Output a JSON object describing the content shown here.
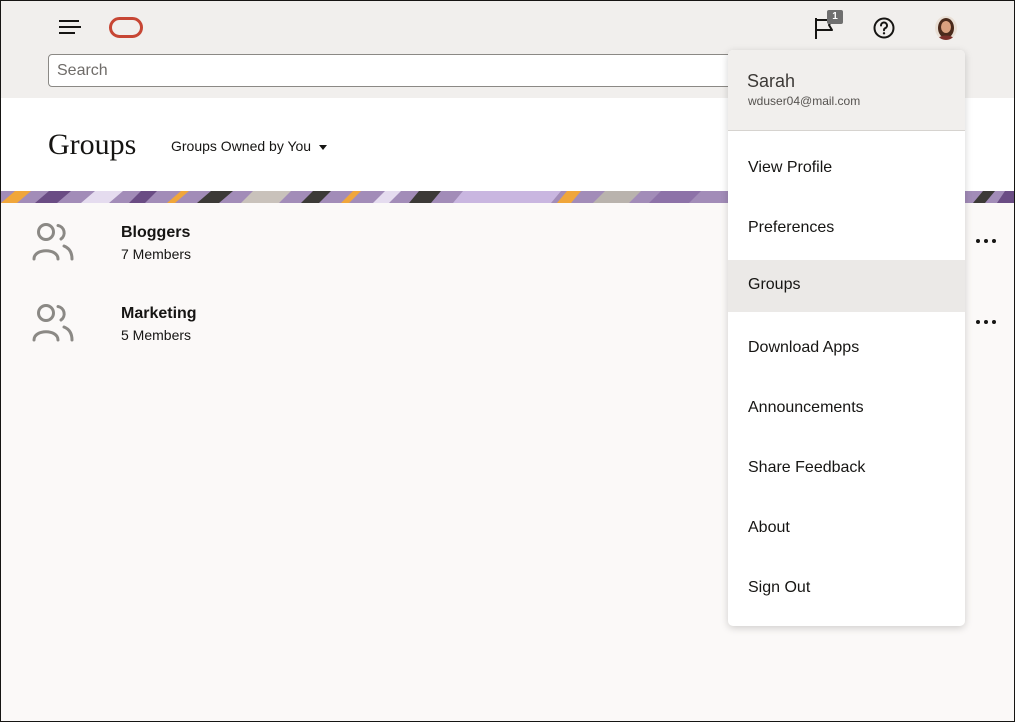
{
  "header": {
    "search_placeholder": "Search",
    "notification_count": "1"
  },
  "page": {
    "title": "Groups",
    "filter_label": "Groups Owned by You"
  },
  "groups": [
    {
      "name": "Bloggers",
      "members": "7 Members"
    },
    {
      "name": "Marketing",
      "members": "5 Members"
    }
  ],
  "user_menu": {
    "name": "Sarah",
    "email": "wduser04@mail.com",
    "items": [
      {
        "label": "View Profile"
      },
      {
        "label": "Preferences"
      },
      {
        "label": "Groups",
        "active": true
      },
      {
        "label": "Download Apps"
      },
      {
        "label": "Announcements"
      },
      {
        "label": "Share Feedback"
      },
      {
        "label": "About"
      },
      {
        "label": "Sign Out"
      }
    ]
  },
  "colors": {
    "brand": "#c74634",
    "header_bg": "#f1efed",
    "active_item_bg": "#ebe9e7",
    "banner_purple": "#8d72a8"
  }
}
